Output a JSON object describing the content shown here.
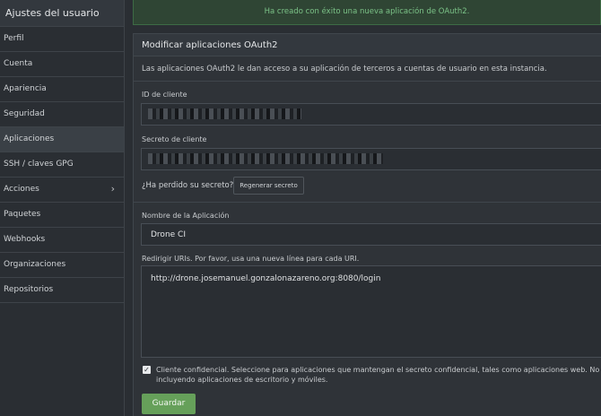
{
  "sidebar": {
    "title": "Ajustes del usuario",
    "items": [
      {
        "label": "Perfil"
      },
      {
        "label": "Cuenta"
      },
      {
        "label": "Apariencia"
      },
      {
        "label": "Seguridad"
      },
      {
        "label": "Aplicaciones"
      },
      {
        "label": "SSH / claves GPG"
      },
      {
        "label": "Acciones",
        "chevron": "›"
      },
      {
        "label": "Paquetes"
      },
      {
        "label": "Webhooks"
      },
      {
        "label": "Organizaciones"
      },
      {
        "label": "Repositorios"
      }
    ],
    "active": "Aplicaciones"
  },
  "banner": {
    "message": "Ha creado con éxito una nueva aplicación de OAuth2."
  },
  "card": {
    "title": "Modificar aplicaciones OAuth2",
    "intro": "Las aplicaciones OAuth2 le dan acceso a su aplicación de terceros a cuentas de usuario en esta instancia.",
    "client_id_label": "ID de cliente",
    "client_secret_label": "Secreto de cliente",
    "lost_secret": "¿Ha perdido su secreto?",
    "regenerate_button": "Regenerar secreto",
    "app_name_label": "Nombre de la Aplicación",
    "app_name_value": "Drone CI",
    "redirect_label": "Redirigir URIs. Por favor, usa una nueva línea para cada URI.",
    "redirect_value": "http://drone.josemanuel.gonzalonazareno.org:8080/login",
    "confidential_checked": true,
    "confidential_label_line1": "Cliente confidencial. Seleccione para aplicaciones que mantengan el secreto confidencial, tales como aplicaciones web. No seleccione p",
    "confidential_label_line2": "incluyendo aplicaciones de escritorio y móviles.",
    "save_button": "Guardar"
  },
  "colors": {
    "accent_green": "#66a05a",
    "success_text": "#7bc287",
    "background": "#2a2e33"
  }
}
